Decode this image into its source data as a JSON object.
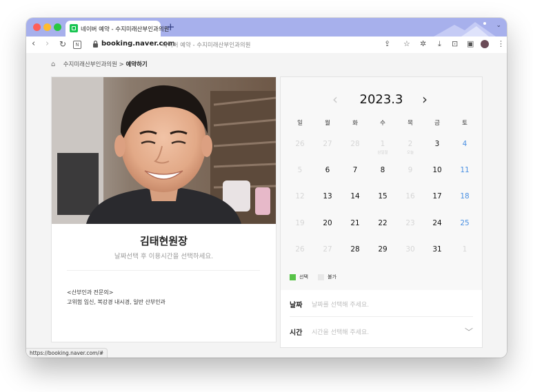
{
  "browser": {
    "tab_title": "네이버 예약 - 수지미래산부인과의원",
    "new_tab_symbol": "+",
    "url_host": "booking.naver.com",
    "url_page_title": "네이버 예약 - 수지미래산부인과의원",
    "status_url": "https://booking.naver.com/#"
  },
  "breadcrumb": {
    "clinic": "수지미래산부인과의원",
    "separator": ">",
    "current": "예약하기"
  },
  "doctor": {
    "name": "김태현원장",
    "instruction": "날짜선택 후 이용시간을 선택하세요.",
    "specialty_title": "<산부인과 전문의>",
    "specialty_desc": "고위험 임신, 복강경 내시경, 일반 산부인과"
  },
  "calendar": {
    "month": "2023.3",
    "weekdays": [
      "일",
      "월",
      "화",
      "수",
      "목",
      "금",
      "토"
    ],
    "weeks": [
      [
        {
          "d": "26",
          "s": "dim"
        },
        {
          "d": "27",
          "s": "dim"
        },
        {
          "d": "28",
          "s": "dim"
        },
        {
          "d": "1",
          "s": "dim",
          "sub": "삼일절"
        },
        {
          "d": "2",
          "s": "dim",
          "sub": "오늘"
        },
        {
          "d": "3",
          "s": ""
        },
        {
          "d": "4",
          "s": "sat"
        }
      ],
      [
        {
          "d": "5",
          "s": "dim"
        },
        {
          "d": "6",
          "s": ""
        },
        {
          "d": "7",
          "s": ""
        },
        {
          "d": "8",
          "s": ""
        },
        {
          "d": "9",
          "s": "dim"
        },
        {
          "d": "10",
          "s": ""
        },
        {
          "d": "11",
          "s": "sat"
        }
      ],
      [
        {
          "d": "12",
          "s": "dim"
        },
        {
          "d": "13",
          "s": ""
        },
        {
          "d": "14",
          "s": ""
        },
        {
          "d": "15",
          "s": ""
        },
        {
          "d": "16",
          "s": "dim"
        },
        {
          "d": "17",
          "s": ""
        },
        {
          "d": "18",
          "s": "sat"
        }
      ],
      [
        {
          "d": "19",
          "s": "dim"
        },
        {
          "d": "20",
          "s": ""
        },
        {
          "d": "21",
          "s": ""
        },
        {
          "d": "22",
          "s": ""
        },
        {
          "d": "23",
          "s": "dim"
        },
        {
          "d": "24",
          "s": ""
        },
        {
          "d": "25",
          "s": "sat"
        }
      ],
      [
        {
          "d": "26",
          "s": "dim"
        },
        {
          "d": "27",
          "s": "dim"
        },
        {
          "d": "28",
          "s": ""
        },
        {
          "d": "29",
          "s": ""
        },
        {
          "d": "30",
          "s": "dim"
        },
        {
          "d": "31",
          "s": ""
        },
        {
          "d": "1",
          "s": "dim"
        }
      ]
    ],
    "legend": [
      {
        "label": "선택",
        "color": "#58c348"
      },
      {
        "label": "불가",
        "color": "#e8e8e8"
      }
    ]
  },
  "form": {
    "date_label": "날짜",
    "date_placeholder": "날짜를 선택해 주세요.",
    "time_label": "시간",
    "time_placeholder": "시간을 선택해 주세요."
  },
  "colors": {
    "tabbar": "#a7b0ec",
    "saturday": "#4a90e2",
    "brand_green": "#19c552"
  },
  "icons": [
    "back-icon",
    "forward-icon",
    "reload-icon",
    "reader-icon",
    "lock-icon",
    "share-icon",
    "bookmark-star-icon",
    "extension-icon",
    "download-icon",
    "screenshot-icon",
    "sidebar-icon",
    "profile-avatar",
    "more-menu-icon",
    "home-icon",
    "chevron-down-icon"
  ]
}
